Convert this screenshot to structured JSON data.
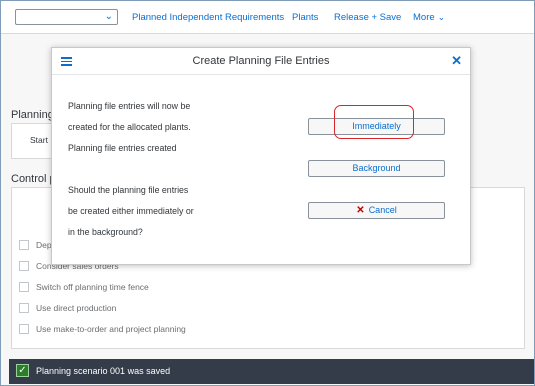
{
  "toolbar": {
    "dropdown_value": "",
    "links": [
      "Planned Independent Requirements",
      "Plants",
      "Release + Save"
    ],
    "more_label": "More"
  },
  "background": {
    "section1_heading": "Planning",
    "start_label": "Start",
    "section2_heading": "Control p",
    "checkbox1": "Dep",
    "checkbox2": "Consider sales orders",
    "checkbox3": "Switch off planning time fence",
    "checkbox4": "Use direct production",
    "checkbox5": "Use make-to-order and project planning"
  },
  "dialog": {
    "title": "Create Planning File Entries",
    "lines": [
      "Planning file entries will now be",
      "created for the allocated plants.",
      "Planning file entries created",
      "Should the planning file entries",
      "be created either immediately or",
      "in the background?"
    ],
    "immediately_label": "Immediately",
    "background_label": "Background",
    "cancel_label": "Cancel"
  },
  "status": {
    "message": "Planning scenario 001 was saved",
    "icon": "checkmark-icon"
  },
  "colors": {
    "accent": "#0a6ed1",
    "highlight": "#d9262b",
    "strip_bg": "#333c48",
    "success": "#2b7d2b"
  }
}
